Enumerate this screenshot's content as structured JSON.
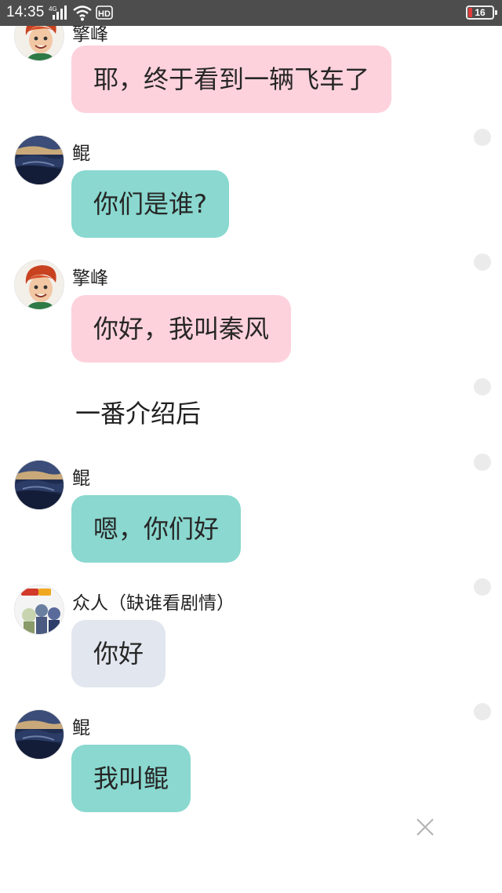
{
  "status_bar": {
    "time": "14:35",
    "network_label": "4G",
    "hd_label": "HD",
    "battery": "16",
    "icons": [
      "signal-icon",
      "wifi-icon",
      "hd-icon",
      "battery-icon"
    ]
  },
  "messages": [
    {
      "speaker": "擎峰",
      "text": "耶，终于看到一辆飞车了",
      "color": "#fed2dc"
    },
    {
      "speaker": "鲲",
      "text": "你们是谁?",
      "color": "#8ad8cf"
    },
    {
      "speaker": "擎峰",
      "text": "你好，我叫秦风",
      "color": "#fed2dc"
    },
    {
      "speaker": "鲲",
      "text": "嗯，你们好",
      "color": "#8ad8cf"
    },
    {
      "speaker": "众人（缺谁看剧情）",
      "text": "你好",
      "color": "#e2e6ee"
    },
    {
      "speaker": "鲲",
      "text": "我叫鲲",
      "color": "#8ad8cf"
    }
  ],
  "narration": "一番介绍后",
  "close_icon": "close-icon"
}
